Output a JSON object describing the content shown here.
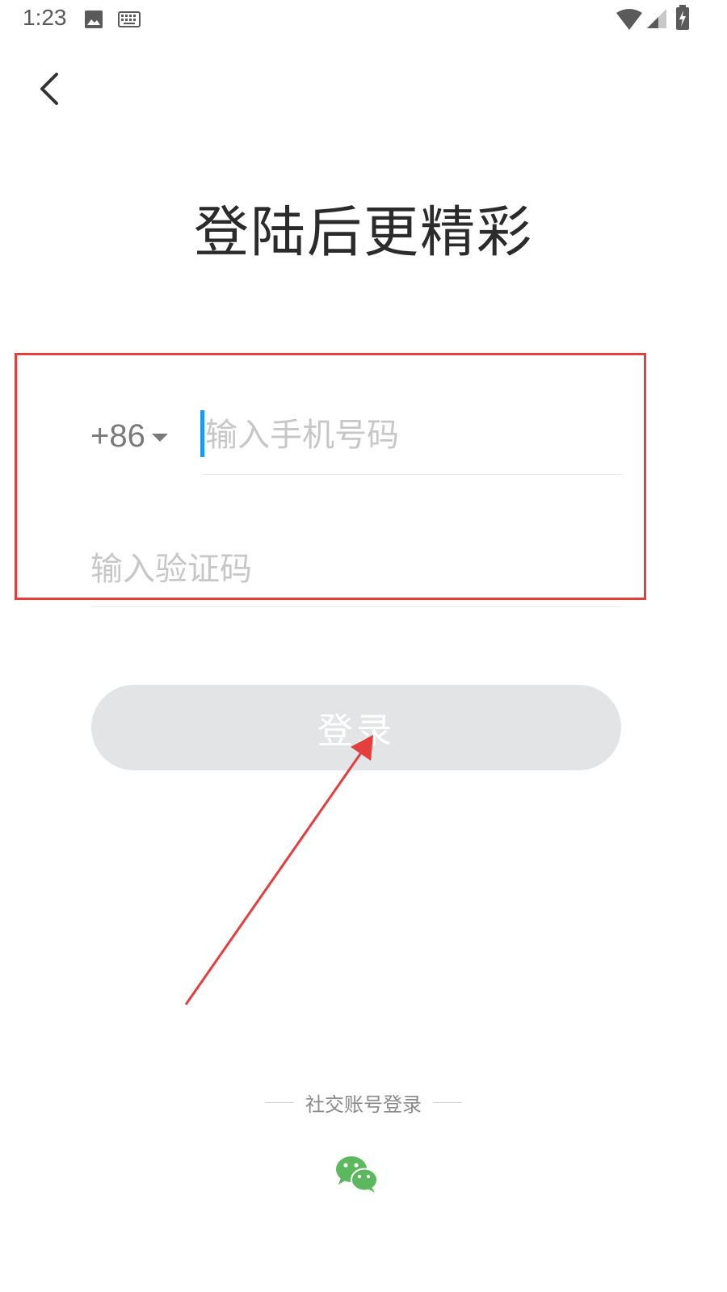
{
  "status_bar": {
    "time": "1:23",
    "icons": [
      "image-icon",
      "keyboard-icon",
      "wifi-icon",
      "signal-icon",
      "battery-charging-icon"
    ]
  },
  "header": {
    "back_icon": "back-chevron-icon"
  },
  "title": "登陆后更精彩",
  "phone": {
    "country_code": "+86",
    "placeholder": "输入手机号码",
    "value": ""
  },
  "verification": {
    "placeholder": "输入验证码",
    "value": ""
  },
  "login_button": {
    "label": "登录",
    "enabled": false
  },
  "social": {
    "label": "社交账号登录",
    "providers": [
      {
        "name": "wechat",
        "icon": "wechat-icon"
      }
    ]
  },
  "colors": {
    "accent_cursor": "#2196f3",
    "annotation": "#e53e3e",
    "button_disabled": "#e3e4e6",
    "wechat": "#5bb85c"
  }
}
